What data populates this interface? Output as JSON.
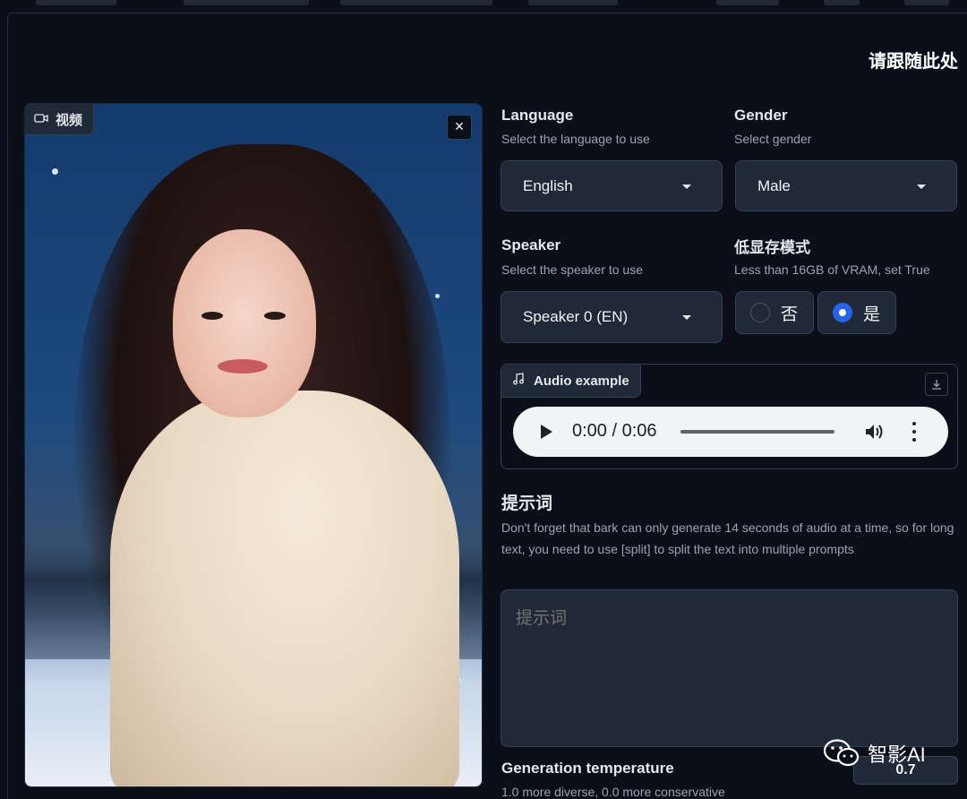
{
  "header": {
    "section_title": "请跟随此处"
  },
  "video": {
    "label": "视频",
    "close_symbol": "×"
  },
  "language": {
    "label": "Language",
    "info": "Select the language to use",
    "value": "English"
  },
  "gender": {
    "label": "Gender",
    "info": "Select gender",
    "value": "Male"
  },
  "speaker": {
    "label": "Speaker",
    "info": "Select the speaker to use",
    "value": "Speaker 0 (EN)"
  },
  "low_vram": {
    "label": "低显存模式",
    "info": "Less than 16GB of VRAM, set True",
    "options": [
      {
        "label": "否",
        "selected": false
      },
      {
        "label": "是",
        "selected": true
      }
    ]
  },
  "audio": {
    "label": "Audio example",
    "time": "0:00 / 0:06"
  },
  "prompt": {
    "label": "提示词",
    "info": "Don't forget that bark can only generate 14 seconds of audio at a time, so for long text, you need to use [split] to split the text into multiple prompts",
    "placeholder": "提示词"
  },
  "temperature": {
    "label": "Generation temperature",
    "info": "1.0 more diverse, 0.0 more conservative",
    "value": "0.7"
  },
  "watermark": {
    "text": "智影AI"
  },
  "colors": {
    "background": "#0b0f19",
    "panel": "#1f2937",
    "border": "#374151",
    "accent": "#2563eb"
  }
}
